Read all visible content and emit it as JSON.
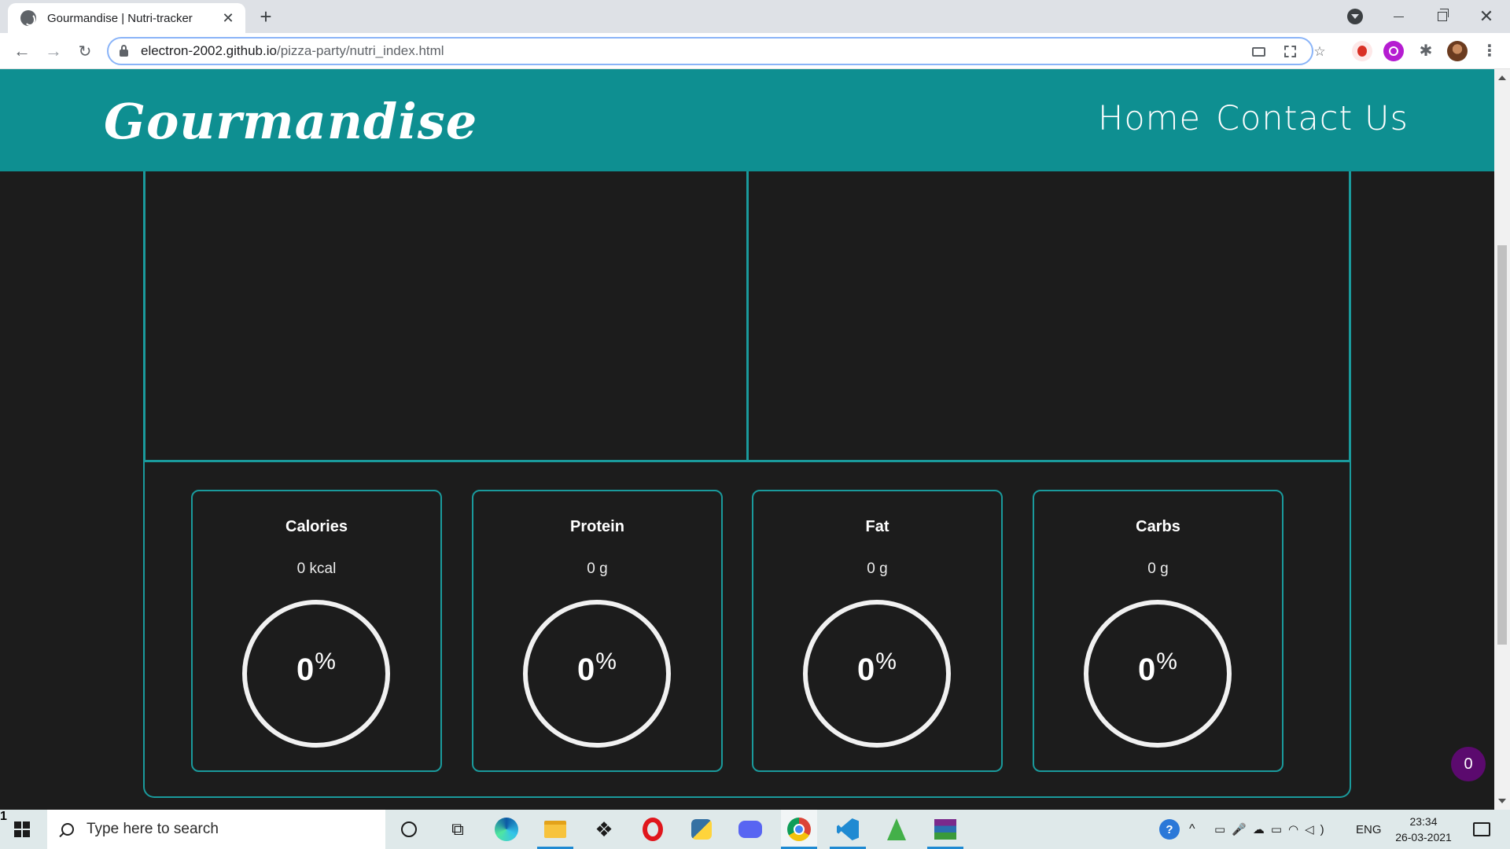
{
  "browser": {
    "tab_title": "Gourmandise | Nutri-tracker",
    "tab_close": "✕",
    "new_tab": "+",
    "url_host": "electron-2002.github.io",
    "url_path": "/pizza-party/nutri_index.html",
    "back": "←",
    "forward": "→",
    "reload": "↻",
    "star": "☆",
    "puzzle": "✱",
    "menu": "⋮",
    "close": "✕"
  },
  "site": {
    "brand": "Gourmandise",
    "nav": {
      "home": "Home",
      "contact": "Contact Us"
    }
  },
  "nutrients": [
    {
      "title": "Calories",
      "value": "0 kcal",
      "percent": "0",
      "percent_sign": "%"
    },
    {
      "title": "Protein",
      "value": "0 g",
      "percent": "0",
      "percent_sign": "%"
    },
    {
      "title": "Fat",
      "value": "0 g",
      "percent": "0",
      "percent_sign": "%"
    },
    {
      "title": "Carbs",
      "value": "0 g",
      "percent": "0",
      "percent_sign": "%"
    }
  ],
  "cart_count": "0",
  "taskbar": {
    "search_placeholder": "Type here to search",
    "taskview": "⧉",
    "dropbox": "❖",
    "help": "?",
    "chevron": "^",
    "system_icons": "▭🎤☁▭◠◁)",
    "language": "ENG",
    "time": "23:34",
    "date": "26-03-2021",
    "notification_count": "1"
  },
  "colors": {
    "header_teal": "#0e8f91",
    "border_teal": "#1a9a9c",
    "page_bg": "#1c1c1c",
    "badge_purple": "#5b0a6e"
  }
}
